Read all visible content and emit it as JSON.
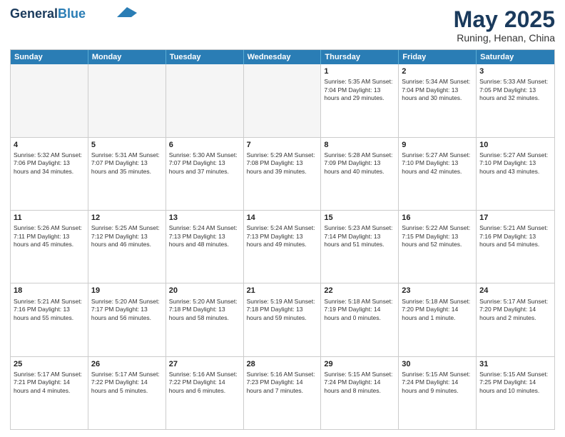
{
  "header": {
    "logo_line1": "General",
    "logo_line2": "Blue",
    "month": "May 2025",
    "location": "Runing, Henan, China"
  },
  "weekdays": [
    "Sunday",
    "Monday",
    "Tuesday",
    "Wednesday",
    "Thursday",
    "Friday",
    "Saturday"
  ],
  "rows": [
    [
      {
        "day": "",
        "text": "",
        "empty": true
      },
      {
        "day": "",
        "text": "",
        "empty": true
      },
      {
        "day": "",
        "text": "",
        "empty": true
      },
      {
        "day": "",
        "text": "",
        "empty": true
      },
      {
        "day": "1",
        "text": "Sunrise: 5:35 AM\nSunset: 7:04 PM\nDaylight: 13 hours\nand 29 minutes.",
        "empty": false
      },
      {
        "day": "2",
        "text": "Sunrise: 5:34 AM\nSunset: 7:04 PM\nDaylight: 13 hours\nand 30 minutes.",
        "empty": false
      },
      {
        "day": "3",
        "text": "Sunrise: 5:33 AM\nSunset: 7:05 PM\nDaylight: 13 hours\nand 32 minutes.",
        "empty": false
      }
    ],
    [
      {
        "day": "4",
        "text": "Sunrise: 5:32 AM\nSunset: 7:06 PM\nDaylight: 13 hours\nand 34 minutes.",
        "empty": false
      },
      {
        "day": "5",
        "text": "Sunrise: 5:31 AM\nSunset: 7:07 PM\nDaylight: 13 hours\nand 35 minutes.",
        "empty": false
      },
      {
        "day": "6",
        "text": "Sunrise: 5:30 AM\nSunset: 7:07 PM\nDaylight: 13 hours\nand 37 minutes.",
        "empty": false
      },
      {
        "day": "7",
        "text": "Sunrise: 5:29 AM\nSunset: 7:08 PM\nDaylight: 13 hours\nand 39 minutes.",
        "empty": false
      },
      {
        "day": "8",
        "text": "Sunrise: 5:28 AM\nSunset: 7:09 PM\nDaylight: 13 hours\nand 40 minutes.",
        "empty": false
      },
      {
        "day": "9",
        "text": "Sunrise: 5:27 AM\nSunset: 7:10 PM\nDaylight: 13 hours\nand 42 minutes.",
        "empty": false
      },
      {
        "day": "10",
        "text": "Sunrise: 5:27 AM\nSunset: 7:10 PM\nDaylight: 13 hours\nand 43 minutes.",
        "empty": false
      }
    ],
    [
      {
        "day": "11",
        "text": "Sunrise: 5:26 AM\nSunset: 7:11 PM\nDaylight: 13 hours\nand 45 minutes.",
        "empty": false
      },
      {
        "day": "12",
        "text": "Sunrise: 5:25 AM\nSunset: 7:12 PM\nDaylight: 13 hours\nand 46 minutes.",
        "empty": false
      },
      {
        "day": "13",
        "text": "Sunrise: 5:24 AM\nSunset: 7:13 PM\nDaylight: 13 hours\nand 48 minutes.",
        "empty": false
      },
      {
        "day": "14",
        "text": "Sunrise: 5:24 AM\nSunset: 7:13 PM\nDaylight: 13 hours\nand 49 minutes.",
        "empty": false
      },
      {
        "day": "15",
        "text": "Sunrise: 5:23 AM\nSunset: 7:14 PM\nDaylight: 13 hours\nand 51 minutes.",
        "empty": false
      },
      {
        "day": "16",
        "text": "Sunrise: 5:22 AM\nSunset: 7:15 PM\nDaylight: 13 hours\nand 52 minutes.",
        "empty": false
      },
      {
        "day": "17",
        "text": "Sunrise: 5:21 AM\nSunset: 7:16 PM\nDaylight: 13 hours\nand 54 minutes.",
        "empty": false
      }
    ],
    [
      {
        "day": "18",
        "text": "Sunrise: 5:21 AM\nSunset: 7:16 PM\nDaylight: 13 hours\nand 55 minutes.",
        "empty": false
      },
      {
        "day": "19",
        "text": "Sunrise: 5:20 AM\nSunset: 7:17 PM\nDaylight: 13 hours\nand 56 minutes.",
        "empty": false
      },
      {
        "day": "20",
        "text": "Sunrise: 5:20 AM\nSunset: 7:18 PM\nDaylight: 13 hours\nand 58 minutes.",
        "empty": false
      },
      {
        "day": "21",
        "text": "Sunrise: 5:19 AM\nSunset: 7:18 PM\nDaylight: 13 hours\nand 59 minutes.",
        "empty": false
      },
      {
        "day": "22",
        "text": "Sunrise: 5:18 AM\nSunset: 7:19 PM\nDaylight: 14 hours\nand 0 minutes.",
        "empty": false
      },
      {
        "day": "23",
        "text": "Sunrise: 5:18 AM\nSunset: 7:20 PM\nDaylight: 14 hours\nand 1 minute.",
        "empty": false
      },
      {
        "day": "24",
        "text": "Sunrise: 5:17 AM\nSunset: 7:20 PM\nDaylight: 14 hours\nand 2 minutes.",
        "empty": false
      }
    ],
    [
      {
        "day": "25",
        "text": "Sunrise: 5:17 AM\nSunset: 7:21 PM\nDaylight: 14 hours\nand 4 minutes.",
        "empty": false
      },
      {
        "day": "26",
        "text": "Sunrise: 5:17 AM\nSunset: 7:22 PM\nDaylight: 14 hours\nand 5 minutes.",
        "empty": false
      },
      {
        "day": "27",
        "text": "Sunrise: 5:16 AM\nSunset: 7:22 PM\nDaylight: 14 hours\nand 6 minutes.",
        "empty": false
      },
      {
        "day": "28",
        "text": "Sunrise: 5:16 AM\nSunset: 7:23 PM\nDaylight: 14 hours\nand 7 minutes.",
        "empty": false
      },
      {
        "day": "29",
        "text": "Sunrise: 5:15 AM\nSunset: 7:24 PM\nDaylight: 14 hours\nand 8 minutes.",
        "empty": false
      },
      {
        "day": "30",
        "text": "Sunrise: 5:15 AM\nSunset: 7:24 PM\nDaylight: 14 hours\nand 9 minutes.",
        "empty": false
      },
      {
        "day": "31",
        "text": "Sunrise: 5:15 AM\nSunset: 7:25 PM\nDaylight: 14 hours\nand 10 minutes.",
        "empty": false
      }
    ]
  ]
}
